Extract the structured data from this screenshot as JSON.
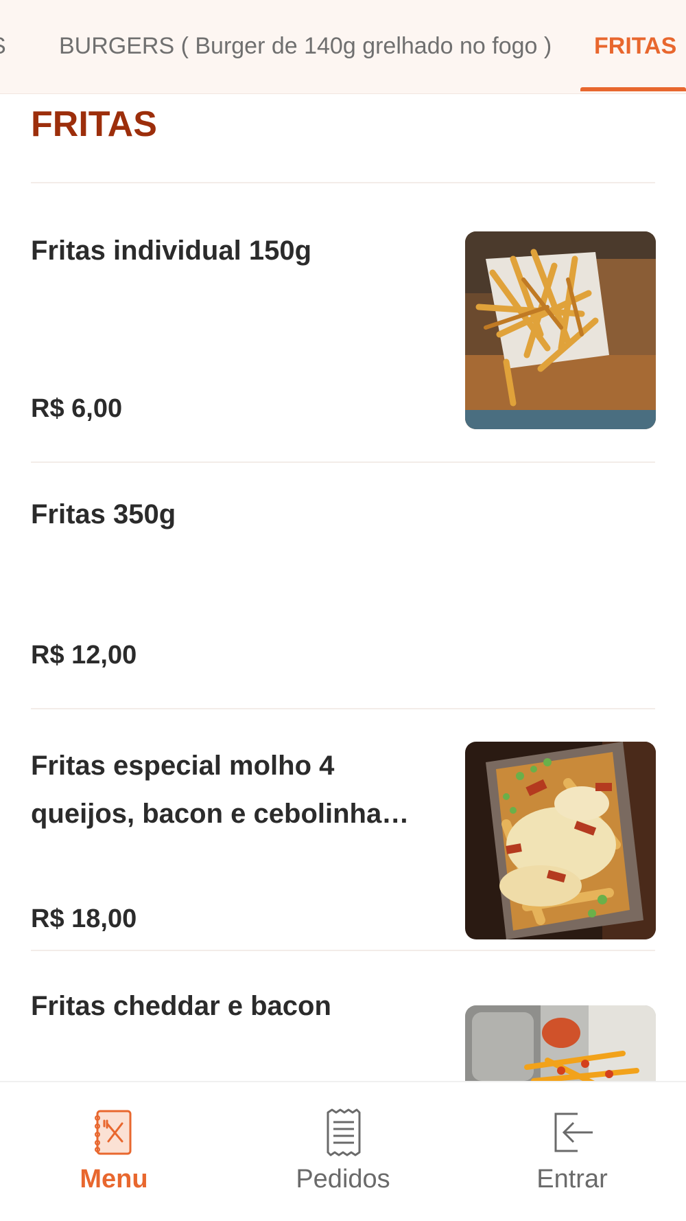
{
  "tabs": {
    "prev_label": "S",
    "burgers_label": "BURGERS ( Burger de 140g grelhado no fogo )",
    "active_label": "FRITAS"
  },
  "section": {
    "title": "FRITAS"
  },
  "items": [
    {
      "name": "Fritas individual 150g",
      "price": "R$ 6,00",
      "has_image": true
    },
    {
      "name": "Fritas 350g",
      "price": "R$ 12,00",
      "has_image": false
    },
    {
      "name": "Fritas especial molho 4 queijos, bacon e cebolinha…",
      "price": "R$ 18,00",
      "has_image": true
    },
    {
      "name": "Fritas cheddar e bacon",
      "price": "",
      "has_image": true
    }
  ],
  "bottom_nav": {
    "menu_label": "Menu",
    "orders_label": "Pedidos",
    "login_label": "Entrar"
  },
  "colors": {
    "accent": "#e8672e",
    "section_title": "#9c2e0b",
    "tabbar_bg": "#fdf6f2",
    "text": "#2b2b2b"
  },
  "icons": [
    "menu-book-icon",
    "receipt-icon",
    "login-arrow-icon"
  ]
}
